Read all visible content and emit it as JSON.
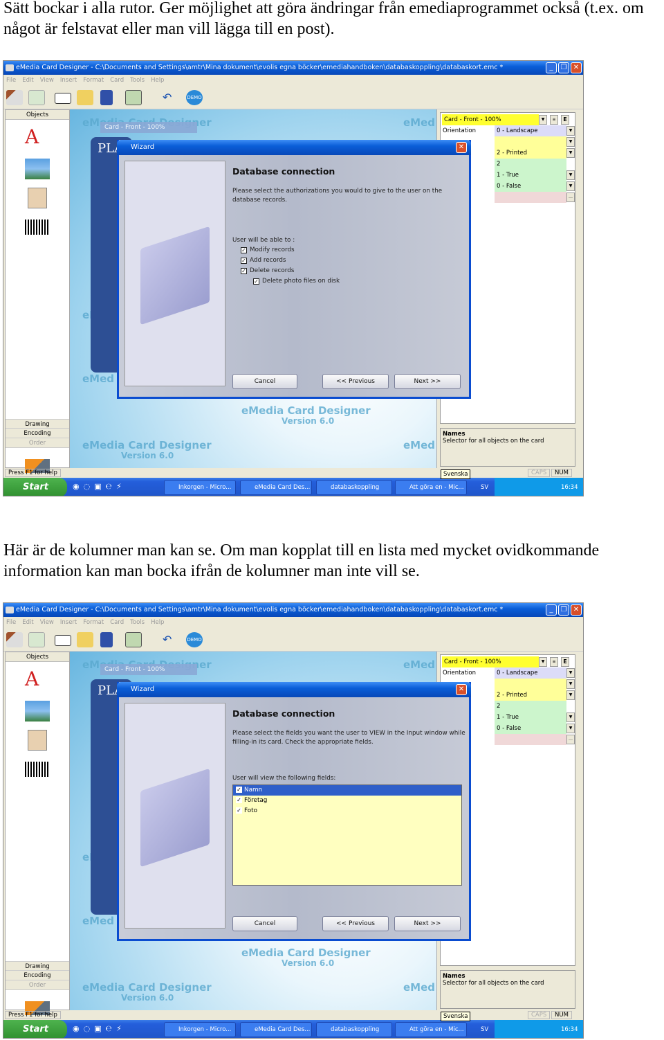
{
  "paragraphs": [
    "Sätt bockar i alla rutor. Ger möjlighet att göra ändringar från emediaprogrammet också (t.ex. om något är felstavat eller man vill lägga till en post).",
    "Här är de kolumner man kan se. Om man kopplat till en lista med mycket ovidkommande information kan man bocka ifrån de kolumner man inte vill se."
  ],
  "app": {
    "title": "eMedia Card Designer - C:\\Documents and Settings\\amtr\\Mina dokument\\evolis egna böcker\\emediahandboken\\databaskoppling\\databaskort.emc *",
    "menu": [
      "File",
      "Edit",
      "View",
      "Insert",
      "Format",
      "Card",
      "Tools",
      "Help"
    ],
    "objects_label": "Objects",
    "left_tabs": [
      "Drawing",
      "Encoding",
      "Order"
    ],
    "card_label": "Card - Front - 100%",
    "watermark": "eMedia Card Designer",
    "watermark_version": "Version 6.0",
    "watermark_short": "eMed",
    "card_text": "PLA",
    "properties": {
      "selector": "Card - Front - 100%",
      "rows": [
        {
          "key": "Orientation",
          "value": "0 - Landscape",
          "color": "#dcdcf8",
          "dropdown": true
        },
        {
          "key": "",
          "value": "",
          "color": "#ffff99",
          "dropdown": true
        },
        {
          "key": "",
          "value": "2 - Printed",
          "color": "#ffff99",
          "dropdown": true
        },
        {
          "key": "",
          "value": "2",
          "color": "#ccf5cc",
          "dropdown": false
        },
        {
          "key": "",
          "value": "1 - True",
          "color": "#ccf5cc",
          "dropdown": true
        },
        {
          "key": "",
          "value": "0 - False",
          "color": "#ccf5cc",
          "dropdown": true
        },
        {
          "key": "",
          "value": "",
          "color": "#f0d8d8",
          "dropdown": false
        }
      ],
      "desc_title": "Names",
      "desc_text": "Selector for all objects on the card"
    },
    "status_help": "Press F1 for help",
    "status_caps": "CAPS",
    "status_num": "NUM",
    "tooltip": "Svenska",
    "taskbar": {
      "start": "Start",
      "tasks": [
        "Inkorgen - Micro...",
        "eMedia Card Des...",
        "databaskoppling",
        "Att göra en - Mic..."
      ],
      "lang": "SV",
      "clock": "16:34"
    },
    "wizard": {
      "title": "Wizard",
      "heading": "Database connection",
      "cancel": "Cancel",
      "previous": "<< Previous",
      "next": "Next >>"
    }
  },
  "screens": [
    {
      "description": "Please select the authorizations you would to give to the user on the database records.",
      "list_label": "User will be able to :",
      "options": [
        {
          "label": "Modify records",
          "checked": true
        },
        {
          "label": "Add records",
          "checked": true
        },
        {
          "label": "Delete records",
          "checked": true
        },
        {
          "label": "Delete photo files on disk",
          "checked": true
        }
      ]
    },
    {
      "description": "Please select the fields you want the user to VIEW in the Input window while filling-in its card. Check the appropriate fields.",
      "list_label": "User will view the following fields:",
      "fields": [
        {
          "label": "Namn",
          "checked": true,
          "selected": true
        },
        {
          "label": "Företag",
          "checked": true,
          "selected": false
        },
        {
          "label": "Foto",
          "checked": true,
          "selected": false
        }
      ]
    }
  ]
}
